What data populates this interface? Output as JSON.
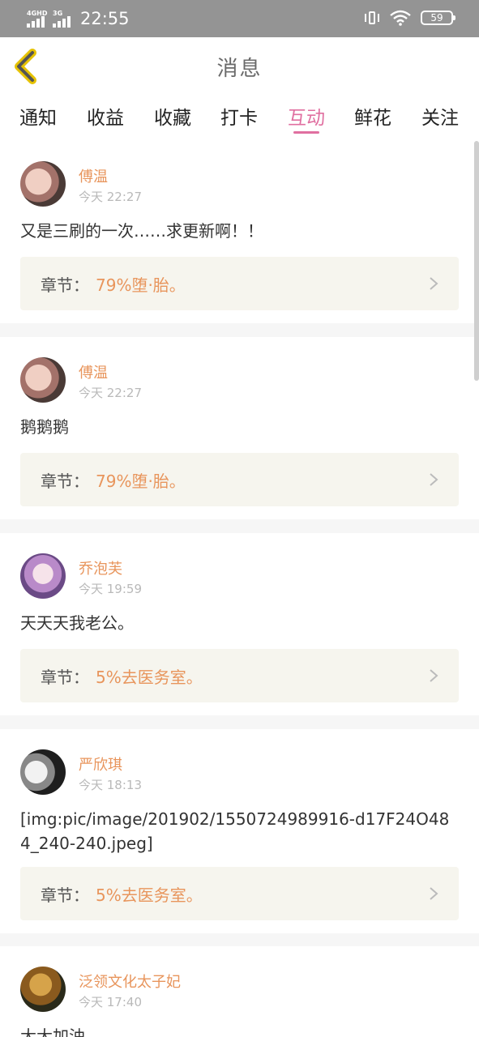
{
  "status_bar": {
    "network_1": "4GHD",
    "network_2": "3G",
    "time": "22:55",
    "battery": "59",
    "icons": [
      "signal-icon",
      "vibrate-icon",
      "wifi-icon",
      "battery-icon"
    ]
  },
  "header": {
    "title": "消息",
    "back_icon": "chevron-left-icon"
  },
  "tabs": [
    {
      "label": "通知",
      "active": false
    },
    {
      "label": "收益",
      "active": false
    },
    {
      "label": "收藏",
      "active": false
    },
    {
      "label": "打卡",
      "active": false
    },
    {
      "label": "互动",
      "active": true
    },
    {
      "label": "鲜花",
      "active": false
    },
    {
      "label": "关注",
      "active": false
    }
  ],
  "colors": {
    "accent_pink": "#e06fa0",
    "username_orange": "#e8955c",
    "chapter_bg": "#f6f5ee"
  },
  "messages": [
    {
      "user": "傅温",
      "time": "今天 22:27",
      "content": "又是三刷的一次……求更新啊！！",
      "chapter_label": "章节：",
      "chapter": "79%堕·胎。"
    },
    {
      "user": "傅温",
      "time": "今天 22:27",
      "content": "鹅鹅鹅",
      "chapter_label": "章节：",
      "chapter": "79%堕·胎。"
    },
    {
      "user": "乔泡芙",
      "time": "今天 19:59",
      "content": "天天天我老公。",
      "chapter_label": "章节：",
      "chapter": "5%去医务室。"
    },
    {
      "user": "严欣琪",
      "time": "今天 18:13",
      "content": "[img:pic/image/201902/1550724989916-d17F24O484_240-240.jpeg]",
      "chapter_label": "章节：",
      "chapter": "5%去医务室。"
    },
    {
      "user": "泛领文化太子妃",
      "time": "今天 17:40",
      "content": "大大加油"
    }
  ]
}
